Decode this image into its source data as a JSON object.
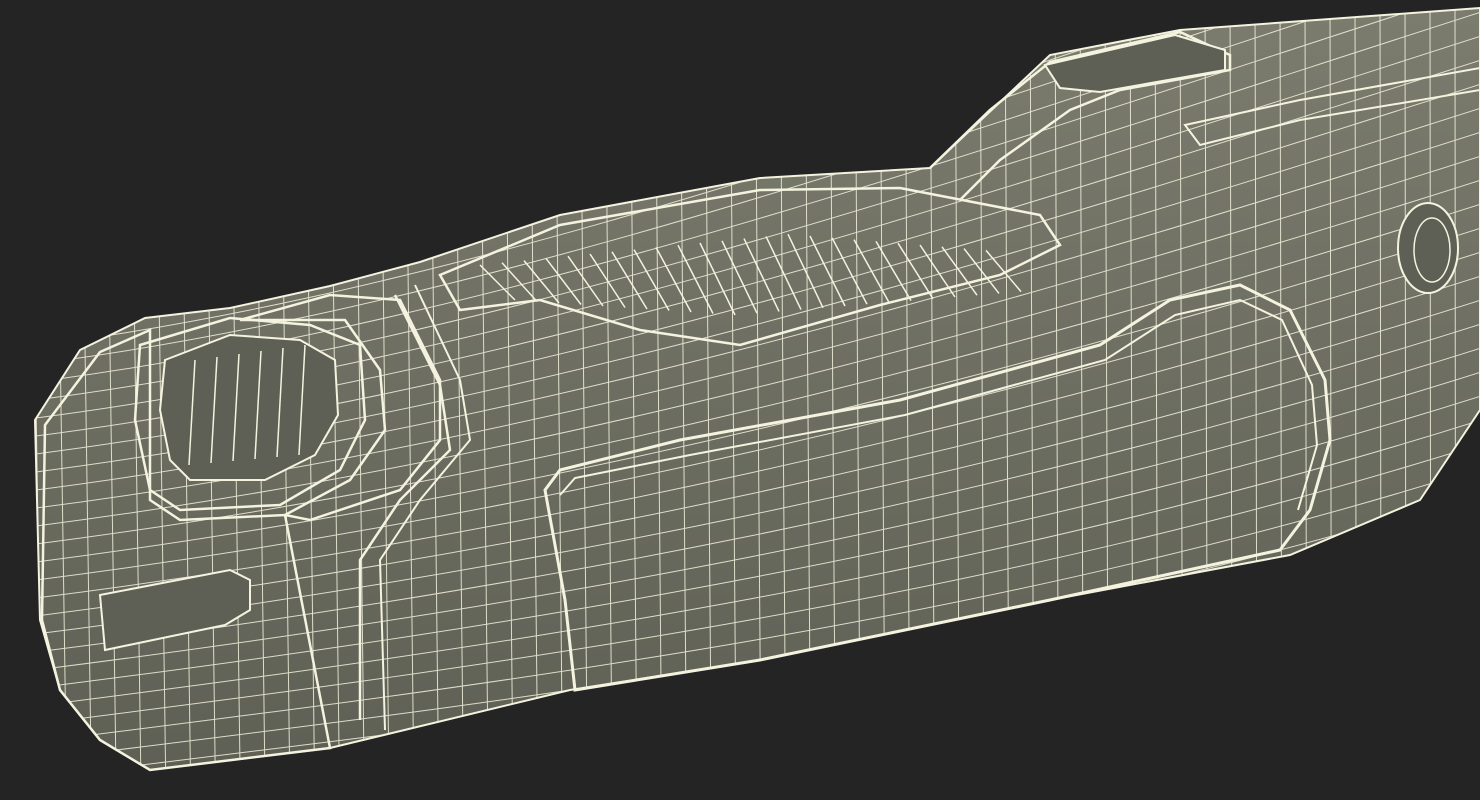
{
  "scene": {
    "background_color": "#242424",
    "surface_color": "#7b7c6e",
    "surface_shadow_color": "#5f6055",
    "wire_color": "#f4f3df",
    "render_style": "wireframe-over-shaded",
    "subject_icon": "handle-icon"
  }
}
